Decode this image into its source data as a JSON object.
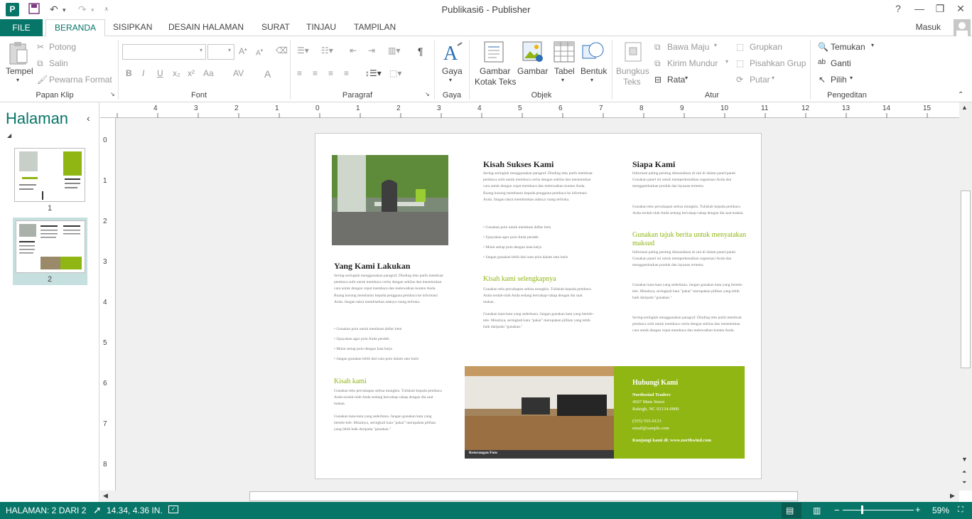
{
  "app": {
    "title": "Publikasi6 - Publisher",
    "logo": "P"
  },
  "window": {
    "help": "?",
    "minimize": "—",
    "restore": "❐",
    "close": "✕"
  },
  "tabs": {
    "file": "FILE",
    "items": [
      "BERANDA",
      "SISIPKAN",
      "DESAIN HALAMAN",
      "SURAT",
      "TINJAU",
      "TAMPILAN"
    ],
    "user": "Masuk"
  },
  "ribbon": {
    "clipboard": {
      "paste": "Tempel",
      "cut": "Potong",
      "copy": "Salin",
      "format_painter": "Pewarna Format",
      "label": "Papan Klip"
    },
    "font": {
      "label": "Font",
      "bold": "B",
      "italic": "I",
      "underline": "U",
      "sub": "x₂",
      "sup": "x²",
      "case": "Aa",
      "spacing": "AV",
      "color": "A"
    },
    "paragraph": {
      "label": "Paragraf",
      "pilcrow": "¶"
    },
    "styles": {
      "label": "Gaya",
      "styles": "Gaya"
    },
    "objects": {
      "label": "Objek",
      "textbox1": "Gambar",
      "textbox2": "Kotak Teks",
      "picture": "Gambar",
      "table": "Tabel",
      "shapes": "Bentuk"
    },
    "arrange": {
      "label": "Atur",
      "wrap1": "Bungkus",
      "wrap2": "Teks",
      "bring": "Bawa Maju",
      "send": "Kirim Mundur",
      "align": "Rata",
      "group": "Grupkan",
      "ungroup": "Pisahkan Grup",
      "rotate": "Putar"
    },
    "editing": {
      "label": "Pengeditan",
      "find": "Temukan",
      "replace": "Ganti",
      "select": "Pilih"
    }
  },
  "pages_pane": {
    "title": "Halaman",
    "collapse": "‹",
    "pages": [
      "1",
      "2"
    ]
  },
  "ruler": {
    "h": [
      "4",
      "3",
      "2",
      "1",
      "0",
      "1",
      "2",
      "3",
      "4",
      "5",
      "6",
      "7",
      "8",
      "9",
      "10",
      "11",
      "12",
      "13",
      "14",
      "15"
    ],
    "v": [
      "0",
      "1",
      "2",
      "3",
      "4",
      "5",
      "6",
      "7",
      "8"
    ]
  },
  "doc": {
    "col1": {
      "heading": "Yang Kami Lakukan",
      "body": "Sering-seringlah menggunakan paragraf. Dinding teks putih membuat pembaca sulit untuk membaca cerita dengan sekilas dan menemukan cara untuk dengan cepat membaca dan melewatkan konten Anda. Ruang kosong membantu kepada pengguna pembaca ke informasi Anda. Jangan takut membiarkan adanya ruang terbuka.",
      "bullets": [
        "Gunakan poin untuk membuat daftar item",
        "Upayakan agar poin Anda pendek",
        "Mulai setiap poin dengan kata kerja",
        "Jangan gunakan lebih dari satu poin dalam satu baris"
      ],
      "sub": "Kisah kami",
      "sub_body1": "Gunakan teks percakapan sebisa mungkin. Tuliskah kepada pembaca Anda seolah-olah Anda sedang bercakap-cakap dengan dia saat makan.",
      "sub_body2": "Gunakan kata-kata yang sederhana. Jangan gunakan kata yang bertele-tele. Misalnya, seringkali kata \"pakai\" merupakan pilihan yang lebih baik daripada \"gunakan.\""
    },
    "col2": {
      "heading": "Kisah Sukses Kami",
      "body": "Sering-seringlah menggunakan paragraf. Dinding teks putih membuat pembaca sulit untuk membaca cerita dengan sekilas dan menemukan cara untuk dengan cepat membaca dan melewatkan konten Anda. Ruang kosong membantu kepada pengguna pembaca ke informasi Anda. Jangan takut membiarkan adanya ruang terbuka.",
      "bullets": [
        "Gunakan poin untuk membuat daftar item",
        "Upayakan agar poin Anda pendek",
        "Mulai setiap poin dengan kata kerja",
        "Jangan gunakan lebih dari satu poin dalam satu baris"
      ],
      "sub": "Kisah kami selengkapnya",
      "sub_body1": "Gunakan teks percakapan sebisa mungkin. Tuliskah kepada pembaca Anda seolah-olah Anda sedang bercakap-cakap dengan dia saat makan.",
      "sub_body2": "Gunakan kata-kata yang sederhana. Jangan gunakan kata yang bertele-tele. Misalnya, seringkali kata \"pakai\" merupakan pilihan yang lebih baik daripada \"gunakan.\""
    },
    "col3": {
      "heading": "Siapa Kami",
      "body1": "Informasi paling penting dimasukkan di sini di dalam panel-panel. Gunakan panel ini untuk memperkenalkan organisasi Anda dan menggambarkan produk dan layanan tertentu.",
      "body2": "Gunakan teks percakapan sebisa mungkin. Tuliskah kepada pembaca Anda seolah-olah Anda sedang bercakap-cakap dengan dia saat makan.",
      "sub": "Gunakan tajuk berita untuk menyatakan maksud",
      "body3": "Informasi paling penting dimasukkan di sini di dalam panel-panel. Gunakan panel ini untuk memperkenalkan organisasi Anda dan menggambarkan produk dan layanan tertentu.",
      "body4": "Gunakan kata-kata yang sederhana. Jangan gunakan kata yang bertele-tele. Misalnya, seringkali kata \"pakai\" merupakan pilihan yang lebih baik daripada \"gunakan.\"",
      "body5": "Sering-seringlah menggunakan paragraf. Dinding teks putih membuat pembaca sulit untuk membaca cerita dengan sekilas dan menemukan cara untuk dengan cepat membaca dan melewatkan konten Anda."
    },
    "caption": "Keterangan Foto",
    "contact": {
      "heading": "Hubungi Kami",
      "company": "Northwind Traders",
      "street": "4567 Main Street",
      "city": "Raleigh, NC 02134-0000",
      "phone": "(555) 555-0123",
      "email": "email@sample.com",
      "web": "Kunjungi kami di: www.northwind.com"
    }
  },
  "status": {
    "page": "HALAMAN: 2 DARI 2",
    "pos": "14.34, 4.36 IN.",
    "zoom": "59%",
    "minus": "−",
    "plus": "+"
  },
  "colors": {
    "accent": "#077568",
    "green": "#8fb612"
  }
}
